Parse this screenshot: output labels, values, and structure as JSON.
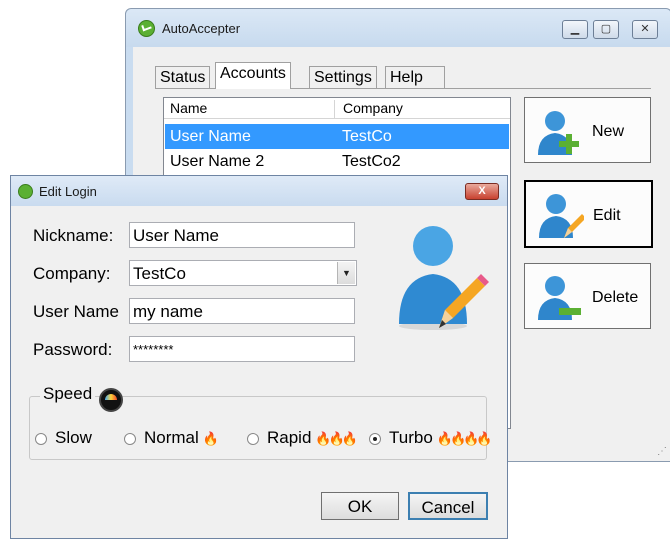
{
  "main_window": {
    "title": "AutoAccepter",
    "tabs": [
      {
        "label": "Status"
      },
      {
        "label": "Accounts",
        "active": true
      },
      {
        "label": "Settings"
      },
      {
        "label": "Help"
      }
    ],
    "table": {
      "columns": [
        "Name",
        "Company"
      ],
      "rows": [
        {
          "name": "User Name",
          "company": "TestCo",
          "selected": true
        },
        {
          "name": "User Name 2",
          "company": "TestCo2",
          "selected": false
        }
      ]
    },
    "buttons": {
      "new_label": "New",
      "edit_label": "Edit",
      "delete_label": "Delete"
    }
  },
  "dialog": {
    "title": "Edit Login",
    "close_label": "X",
    "fields": {
      "nickname_label": "Nickname:",
      "nickname_value": "User Name",
      "company_label": "Company:",
      "company_value": "TestCo",
      "username_label": "User Name",
      "username_value": "my name",
      "password_label": "Password:",
      "password_value": "********"
    },
    "speed": {
      "legend": "Speed",
      "options": [
        {
          "label": "Slow",
          "selected": false,
          "flames": 0
        },
        {
          "label": "Normal",
          "selected": false,
          "flames": 1
        },
        {
          "label": "Rapid",
          "selected": false,
          "flames": 3
        },
        {
          "label": "Turbo",
          "selected": true,
          "flames": 4
        }
      ]
    },
    "ok_label": "OK",
    "cancel_label": "Cancel"
  },
  "colors": {
    "selection": "#3399ff",
    "window_frame": "#c9dcf0",
    "accent_green": "#5bb033",
    "flame": "#f08a1c"
  }
}
